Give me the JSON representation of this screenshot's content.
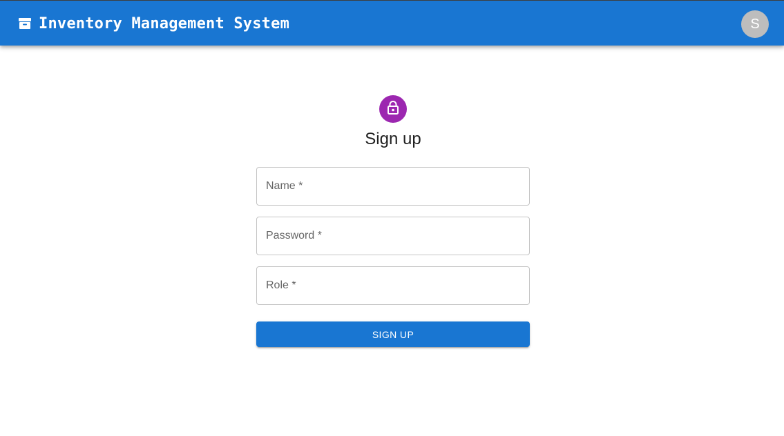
{
  "header": {
    "title": "Inventory Management System",
    "brand_icon": "archive-box-icon",
    "avatar_initial": "S",
    "background_color": "#1976d2"
  },
  "form": {
    "icon": "lock-icon",
    "icon_background": "#9c27b0",
    "title": "Sign up",
    "fields": [
      {
        "label": "Name *",
        "value": ""
      },
      {
        "label": "Password *",
        "value": ""
      },
      {
        "label": "Role *",
        "value": ""
      }
    ],
    "submit_label": "SIGN UP",
    "submit_color": "#1976d2"
  }
}
